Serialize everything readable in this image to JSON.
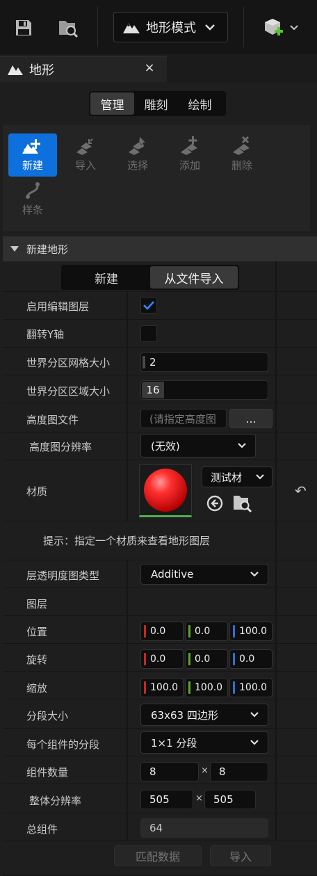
{
  "toolbar": {
    "mode_label": "地形模式",
    "icons": [
      "save-icon",
      "browse-folder-icon",
      "landscape-icon",
      "chevron-down-icon",
      "add-actor-icon"
    ]
  },
  "tab": {
    "title": "地形",
    "close": "×"
  },
  "mode_tabs": [
    {
      "label": "管理",
      "active": true
    },
    {
      "label": "雕刻",
      "active": false
    },
    {
      "label": "绘制",
      "active": false
    }
  ],
  "tools": [
    {
      "label": "新建",
      "icon": "new-landscape-icon",
      "active": true
    },
    {
      "label": "导入",
      "icon": "import-icon",
      "active": false
    },
    {
      "label": "选择",
      "icon": "select-icon",
      "active": false
    },
    {
      "label": "添加",
      "icon": "add-icon",
      "active": false
    },
    {
      "label": "删除",
      "icon": "delete-icon",
      "active": false
    },
    {
      "label": "样条",
      "icon": "spline-icon",
      "active": false
    }
  ],
  "section": {
    "title": "新建地形"
  },
  "source_tabs": [
    {
      "label": "新建",
      "active": false
    },
    {
      "label": "从文件导入",
      "active": true
    }
  ],
  "props": {
    "enable_edit_layers": {
      "label": "启用编辑图层",
      "checked": true
    },
    "flip_y": {
      "label": "翻转Y轴",
      "checked": false
    },
    "wp_grid_size": {
      "label": "世界分区网格大小",
      "value": "2"
    },
    "wp_region_size": {
      "label": "世界分区区域大小",
      "value": "16"
    },
    "heightmap_file": {
      "label": "高度图文件",
      "placeholder": "(请指定高度图",
      "browse": "..."
    },
    "heightmap_res": {
      "label": "高度图分辨率",
      "value": "(无效)"
    },
    "material": {
      "label": "材质",
      "value": "测试材",
      "reset": "↶"
    },
    "hint": "提示：指定一个材质来查看地形图层",
    "layer_alpha_type": {
      "label": "层透明度图类型",
      "value": "Additive"
    },
    "layers": {
      "label": "图层"
    },
    "location": {
      "label": "位置",
      "x": "0.0",
      "y": "0.0",
      "z": "100.0"
    },
    "rotation": {
      "label": "旋转",
      "x": "0.0",
      "y": "0.0",
      "z": "0.0"
    },
    "scale": {
      "label": "缩放",
      "x": "100.0",
      "y": "100.0",
      "z": "100.0"
    },
    "section_size": {
      "label": "分段大小",
      "value": "63x63 四边形"
    },
    "sections_per_component": {
      "label": "每个组件的分段",
      "value": "1×1 分段"
    },
    "component_count": {
      "label": "组件数量",
      "x": "8",
      "y": "8",
      "sep": "×"
    },
    "overall_res": {
      "label": "整体分辨率",
      "x": "505",
      "y": "505",
      "sep": "×"
    },
    "total_components": {
      "label": "总组件",
      "value": "64"
    }
  },
  "footer": {
    "fit_data": "匹配数据",
    "import": "导入"
  },
  "colors": {
    "accent": "#0e70dc",
    "x_axis": "#c8281e",
    "y_axis": "#5ea82a",
    "z_axis": "#2f6fd6",
    "checkbox_check": "#2a8cff"
  }
}
